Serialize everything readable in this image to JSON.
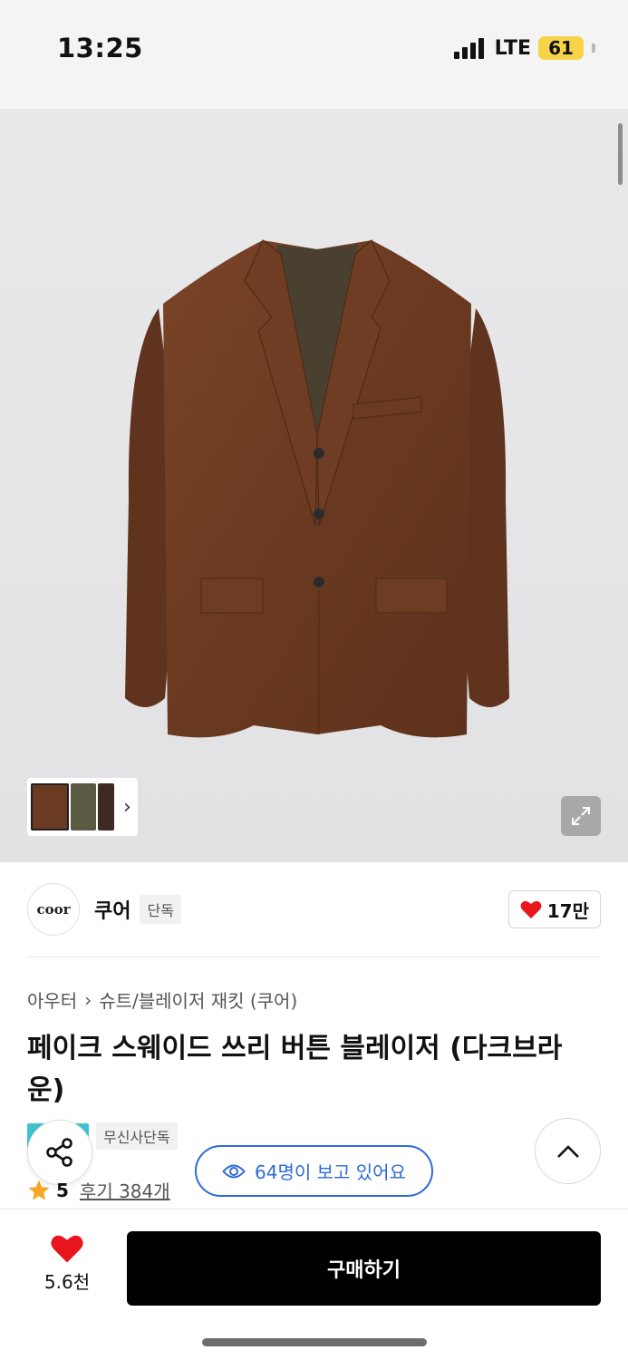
{
  "status_bar": {
    "time": "13:25",
    "network": "LTE",
    "battery": "61"
  },
  "brand": {
    "logo_text": "coor",
    "name": "쿠어",
    "badge": "단독",
    "likes": "17만"
  },
  "breadcrumb": {
    "category": "아우터",
    "subcategory": "슈트/블레이저 재킷 (쿠어)"
  },
  "product": {
    "title": "페이크 스웨이드 쓰리 버튼 블레이저 (다크브라운)",
    "store_badge": "무신사단독",
    "rating": "5",
    "reviews": "후기 384개"
  },
  "viewers": "64명이 보고 있어요",
  "bottom_bar": {
    "wish_count": "5.6천",
    "buy_label": "구매하기"
  },
  "colors": {
    "accent_blue": "#2d6ad9",
    "heart_red": "#e8151d",
    "star": "#f5a623",
    "jacket_brown": "#6b3a22"
  },
  "icons": [
    "chevron-right-icon",
    "expand-icon",
    "heart-icon",
    "share-icon",
    "eye-icon",
    "chevron-up-icon",
    "star-icon"
  ]
}
